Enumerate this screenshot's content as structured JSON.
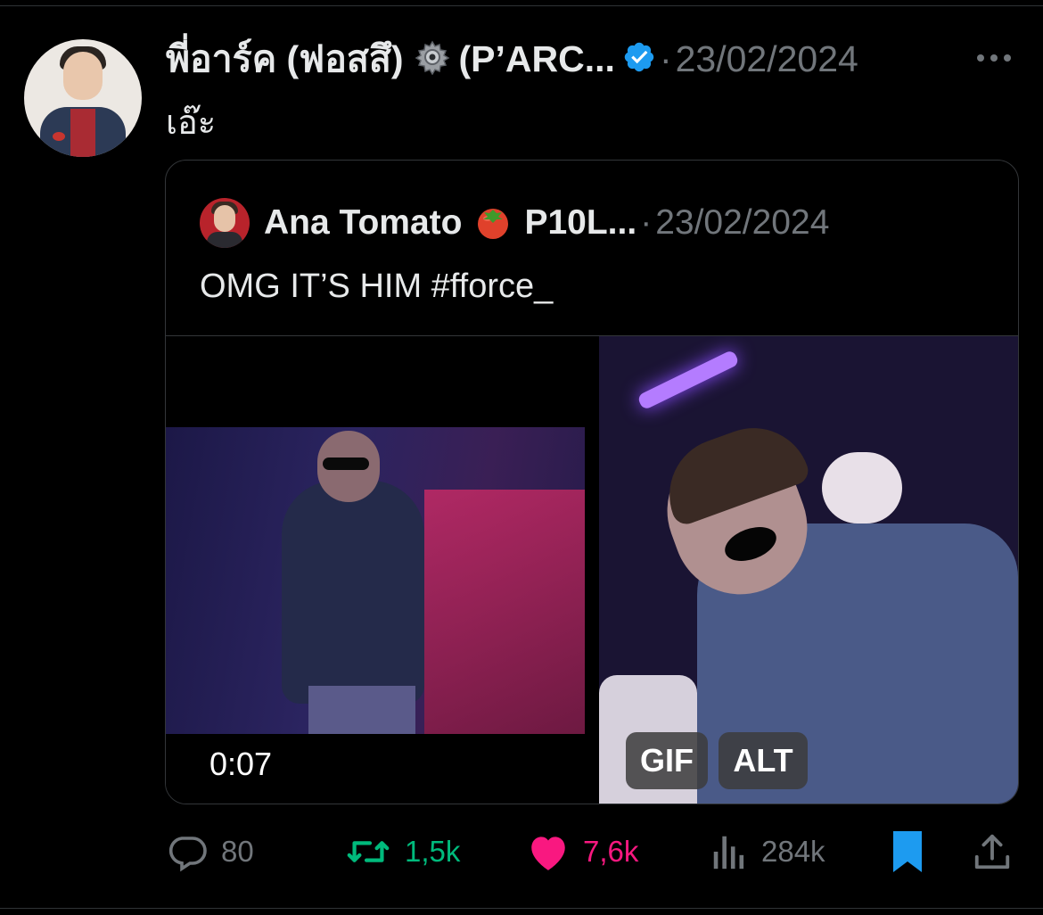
{
  "tweet": {
    "author_name": "พี่อาร์ค (ฟอสสึ)",
    "author_handle": "(P’ARC...",
    "separator": "·",
    "date": "23/02/2024",
    "text": "เอ๊ะ",
    "icons": {
      "emoji": "gear-icon",
      "verified": "verified-badge-icon",
      "more": "more-options-icon"
    }
  },
  "quote": {
    "author_name": "Ana Tomato",
    "author_handle": "P10L...",
    "separator": "·",
    "date": "23/02/2024",
    "text": "OMG IT’S HIM #fforce_",
    "icons": {
      "emoji": "tomato-icon"
    },
    "media": [
      {
        "type": "video",
        "duration": "0:07"
      },
      {
        "type": "gif",
        "badge": "GIF",
        "alt_badge": "ALT"
      }
    ]
  },
  "actions": {
    "replies": "80",
    "retweets": "1,5k",
    "likes": "7,6k",
    "views": "284k",
    "bookmarked": true
  },
  "colors": {
    "background": "#000000",
    "text": "#e7e9ea",
    "muted": "#71767b",
    "verified": "#1d9bf0",
    "retweet": "#00ba7c",
    "like": "#f91880",
    "bookmark": "#1d9bf0"
  }
}
